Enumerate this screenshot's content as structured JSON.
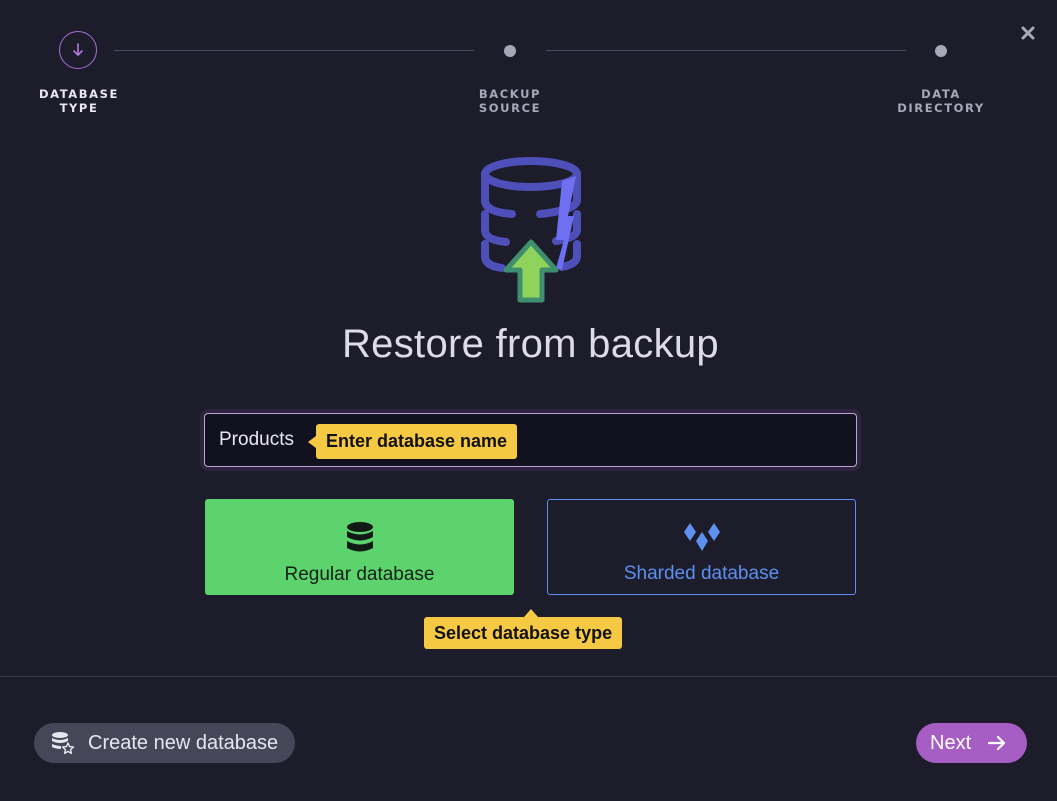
{
  "stepper": {
    "steps": [
      {
        "label_line1": "DATABASE",
        "label_line2": "TYPE",
        "state": "active"
      },
      {
        "label_line1": "BACKUP",
        "label_line2": "SOURCE",
        "state": "pending"
      },
      {
        "label_line1": "DATA",
        "label_line2": "DIRECTORY",
        "state": "pending"
      }
    ]
  },
  "main": {
    "title": "Restore from backup",
    "database_name": {
      "value": "Products",
      "hint": "Enter database name"
    },
    "types": [
      {
        "label": "Regular database",
        "icon": "database-icon",
        "selected": true
      },
      {
        "label": "Sharded database",
        "icon": "sharded-icon",
        "selected": false
      }
    ],
    "type_hint": "Select database type"
  },
  "footer": {
    "create_label": "Create new database",
    "next_label": "Next"
  },
  "colors": {
    "background": "#1c1c2a",
    "accent_purple": "#a65dc4",
    "selected_green": "#5dd36e",
    "sharded_blue": "#5d90ef",
    "hint_yellow": "#f6c945"
  }
}
